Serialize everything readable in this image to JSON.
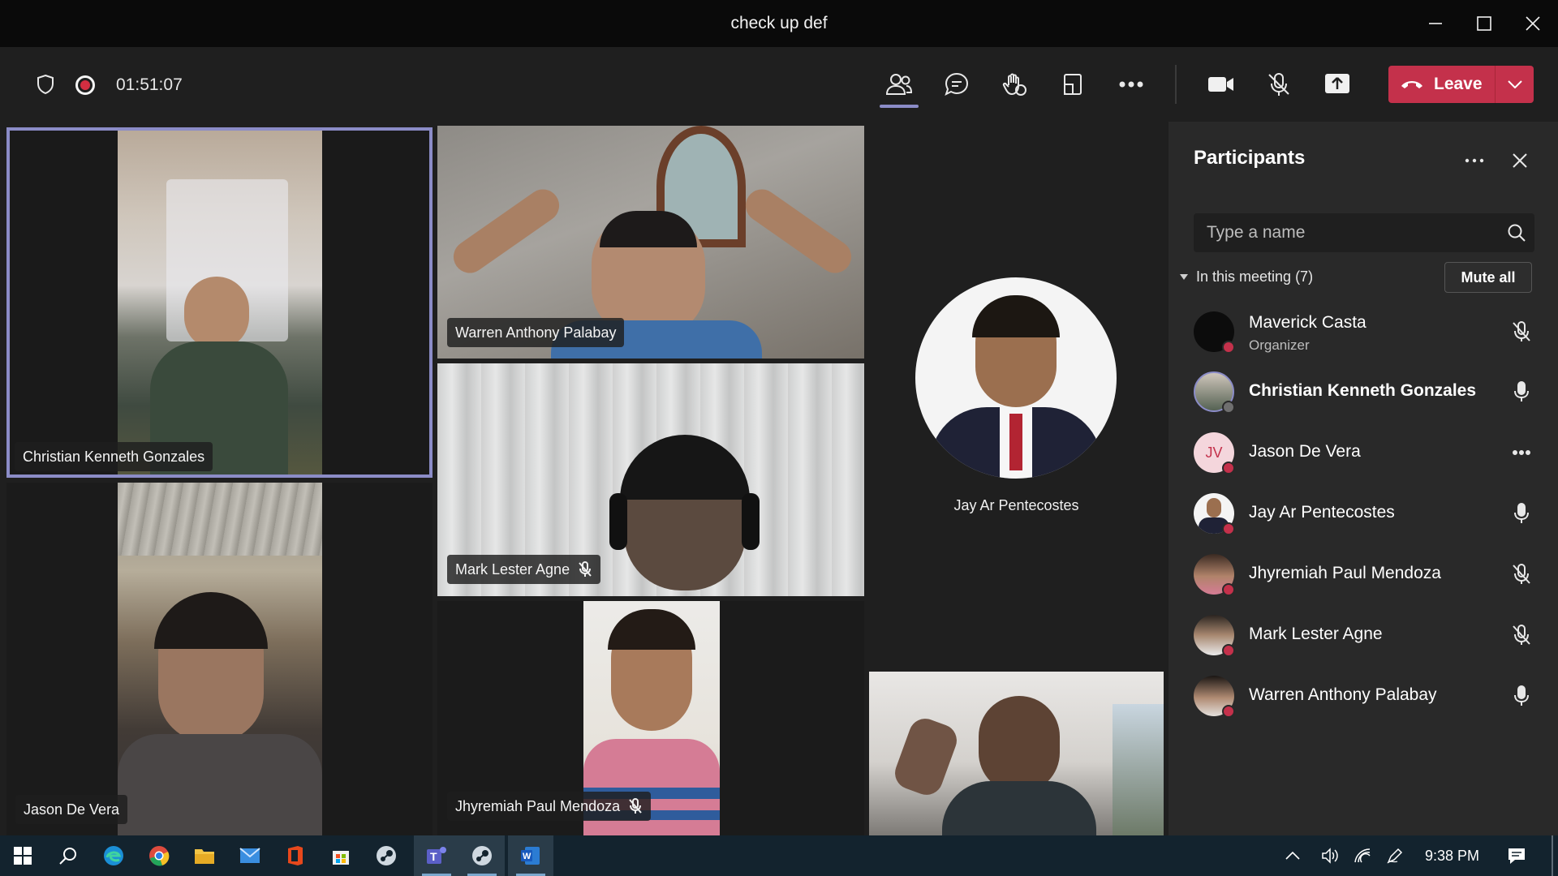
{
  "window": {
    "title": "check up def"
  },
  "toolbar": {
    "timer": "01:51:07",
    "leave_label": "Leave"
  },
  "stage": {
    "tiles": [
      {
        "name": "Christian Kenneth Gonzales",
        "muted": false,
        "active_speaker": true
      },
      {
        "name": "Warren Anthony Palabay",
        "muted": false
      },
      {
        "name": "Mark Lester Agne",
        "muted": true
      },
      {
        "name": "Jay Ar Pentecostes",
        "muted": false
      },
      {
        "name": "Jason De Vera",
        "muted": false
      },
      {
        "name": "Jhyremiah Paul Mendoza",
        "muted": true
      },
      {
        "name": "",
        "muted": false
      }
    ]
  },
  "panel": {
    "title": "Participants",
    "search_placeholder": "Type a name",
    "section_label": "In this meeting (7)",
    "mute_all_label": "Mute all",
    "participants": [
      {
        "name": "Maverick Casta",
        "role": "Organizer",
        "status_icon": "mic-off-icon"
      },
      {
        "name": "Christian Kenneth Gonzales",
        "role": "",
        "status_icon": "mic-icon",
        "bold": true
      },
      {
        "name": "Jason De Vera",
        "initials": "JV",
        "role": "",
        "status_icon": "more-icon"
      },
      {
        "name": "Jay Ar Pentecostes",
        "role": "",
        "status_icon": "mic-icon"
      },
      {
        "name": "Jhyremiah Paul Mendoza",
        "role": "",
        "status_icon": "mic-off-icon"
      },
      {
        "name": "Mark Lester Agne",
        "role": "",
        "status_icon": "mic-off-icon"
      },
      {
        "name": "Warren Anthony Palabay",
        "role": "",
        "status_icon": "mic-icon"
      }
    ]
  },
  "taskbar": {
    "time": "9:38 PM"
  },
  "colors": {
    "accent": "#8b8cc7",
    "leave": "#c4314b",
    "panel_bg": "#292929",
    "stage_bg": "#1f1f1f"
  }
}
